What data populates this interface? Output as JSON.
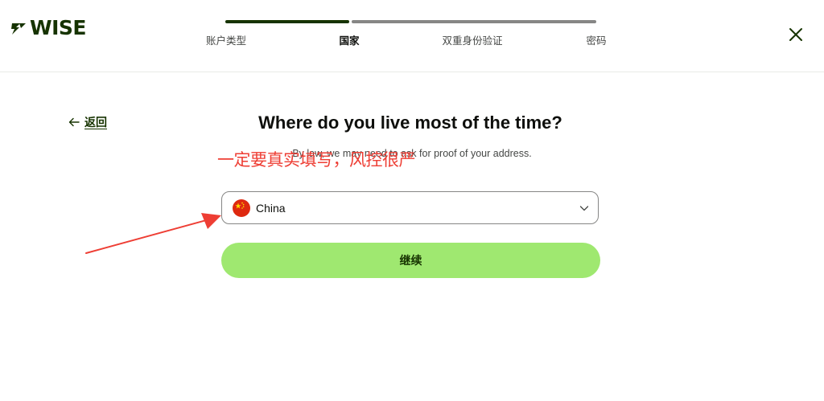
{
  "header": {
    "logo_text": "WISE",
    "logo_icon": "wise-flag-icon",
    "steps": [
      {
        "label": "账户类型",
        "state": "done"
      },
      {
        "label": "国家",
        "state": "active"
      },
      {
        "label": "双重身份验证",
        "state": "todo"
      },
      {
        "label": "密码",
        "state": "todo"
      }
    ],
    "close_icon": "close-icon"
  },
  "back": {
    "label": "返回",
    "icon": "arrow-left-icon"
  },
  "main": {
    "title": "Where do you live most of the time?",
    "subtitle": "By law, we may need to ask for proof of your address.",
    "country_select": {
      "value": "China",
      "flag_icon": "china-flag-icon",
      "chevron_icon": "chevron-down-icon"
    },
    "continue_label": "继续"
  },
  "annotation": {
    "text": "一定要真实填写，风控很严",
    "color": "#ee3e34"
  },
  "colors": {
    "brand_dark": "#163300",
    "brand_green": "#9fe870",
    "annotation_red": "#ee3e34"
  }
}
